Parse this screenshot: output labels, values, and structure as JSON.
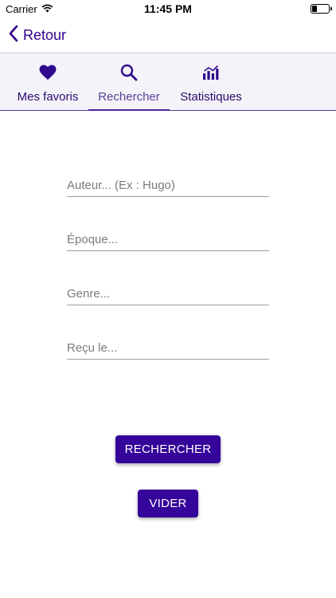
{
  "status_bar": {
    "carrier": "Carrier",
    "time": "11:45 PM"
  },
  "nav": {
    "back_label": "Retour"
  },
  "tabs": [
    {
      "label": "Mes favoris",
      "icon": "heart-icon",
      "active": false
    },
    {
      "label": "Rechercher",
      "icon": "search-icon",
      "active": true
    },
    {
      "label": "Statistiques",
      "icon": "stats-chart-icon",
      "active": false
    }
  ],
  "form": {
    "author_placeholder": "Auteur... (Ex : Hugo)",
    "epoch_placeholder": "Époque...",
    "genre_placeholder": "Genre...",
    "received_placeholder": "Reçu le..."
  },
  "buttons": {
    "search_label": "RECHERCHER",
    "clear_label": "VIDER"
  },
  "colors": {
    "primary": "#35049a",
    "accent_text": "#33008d",
    "tab_bg": "#f4f3fa"
  }
}
